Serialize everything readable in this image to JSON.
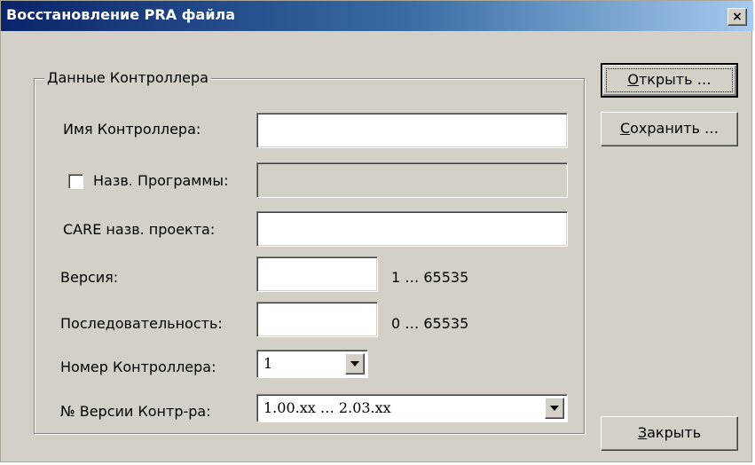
{
  "window": {
    "title": "Восстановление PRA файла",
    "close_label": "×"
  },
  "group": {
    "title": "Данные Контроллера"
  },
  "fields": {
    "controller_name": {
      "label": "Имя Контроллера:",
      "value": ""
    },
    "program_name": {
      "label": "Назв. Программы:",
      "value": "",
      "checked": false,
      "enabled": false
    },
    "care_project": {
      "label": "CARE назв. проекта:",
      "value": ""
    },
    "version": {
      "label": "Версия:",
      "value": "",
      "range": "1 … 65535"
    },
    "sequence": {
      "label": "Последовательность:",
      "value": "",
      "range": "0 … 65535"
    },
    "controller_number": {
      "label": "Номер Контроллера:",
      "value": "1"
    },
    "controller_version": {
      "label": "№ Версии Контр-ра:",
      "value": "1.00.xx … 2.03.xx"
    }
  },
  "buttons": {
    "open": {
      "mnemonic": "О",
      "rest": "ткрыть …"
    },
    "save": {
      "mnemonic": "С",
      "rest": "охранить …"
    },
    "close": {
      "mnemonic": "З",
      "rest": "акрыть"
    }
  }
}
